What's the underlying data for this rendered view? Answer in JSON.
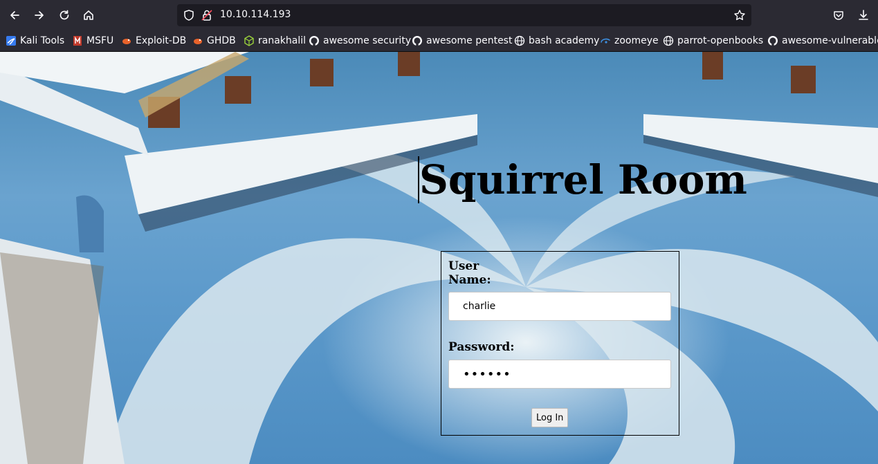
{
  "browser": {
    "url": "10.10.114.193",
    "bookmarks": [
      {
        "label": "Kali Tools",
        "icon": "kali-dragon-icon"
      },
      {
        "label": "MSFU",
        "icon": "msfu-icon"
      },
      {
        "label": "Exploit-DB",
        "icon": "exploit-db-icon"
      },
      {
        "label": "GHDB",
        "icon": "ghdb-icon"
      },
      {
        "label": "ranakhalil",
        "icon": "cube-icon"
      },
      {
        "label": "awesome security",
        "icon": "github-icon"
      },
      {
        "label": "awesome pentest",
        "icon": "github-icon"
      },
      {
        "label": "bash academy",
        "icon": "globe-icon"
      },
      {
        "label": "zoomeye",
        "icon": "zoomeye-icon"
      },
      {
        "label": "parrot-openbooks",
        "icon": "globe-icon"
      },
      {
        "label": "awesome-vulnerable",
        "icon": "github-icon"
      }
    ]
  },
  "page": {
    "title": "Squirrel Room",
    "form": {
      "username_label": "User Name:",
      "username_value": "charlie",
      "password_label": "Password:",
      "password_value": "••••••",
      "submit_label": "Log In"
    }
  },
  "colors": {
    "chrome_bg": "#2b2a33",
    "urlbar_bg": "#1c1b22",
    "chrome_text": "#fbfbfe",
    "floor_blue": "#5d9acb"
  }
}
